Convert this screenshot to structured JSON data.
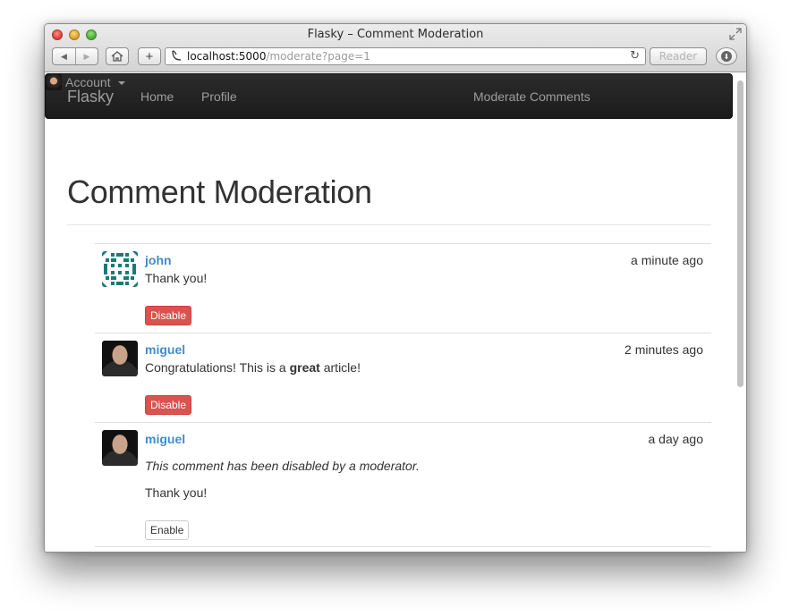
{
  "window": {
    "title": "Flasky – Comment Moderation",
    "colors": {
      "close": "#e0443a",
      "minimize": "#e2a52c",
      "zoom": "#52b33a"
    }
  },
  "toolbar": {
    "back_icon": "back-arrow-icon",
    "forward_icon": "forward-arrow-icon",
    "home_icon": "home-icon",
    "add_label": "+",
    "url_host": "localhost:5000",
    "url_path": "/moderate?page=1",
    "reload_icon": "reload-icon",
    "reader_label": "Reader",
    "download_icon": "download-icon"
  },
  "navbar": {
    "brand": "Flasky",
    "links": [
      "Home",
      "Profile"
    ],
    "moderate": "Moderate Comments",
    "account": "Account"
  },
  "page": {
    "title": "Comment Moderation"
  },
  "comments": [
    {
      "author": "john",
      "avatar": "identicon",
      "date": "a minute ago",
      "body": "Thank you!",
      "disabled": false,
      "action": "Disable"
    },
    {
      "author": "miguel",
      "avatar": "photo",
      "date": "2 minutes ago",
      "body_before": "Congratulations! This is a ",
      "body_strong": "great",
      "body_after": " article!",
      "disabled": false,
      "action": "Disable"
    },
    {
      "author": "miguel",
      "avatar": "photo",
      "date": "a day ago",
      "disabled_note": "This comment has been disabled by a moderator.",
      "body": "Thank you!",
      "disabled": true,
      "action": "Enable"
    }
  ],
  "colors": {
    "link": "#428bca",
    "danger": "#d9534f",
    "navbar": "#222222",
    "identicon": "#1a7a7a"
  }
}
